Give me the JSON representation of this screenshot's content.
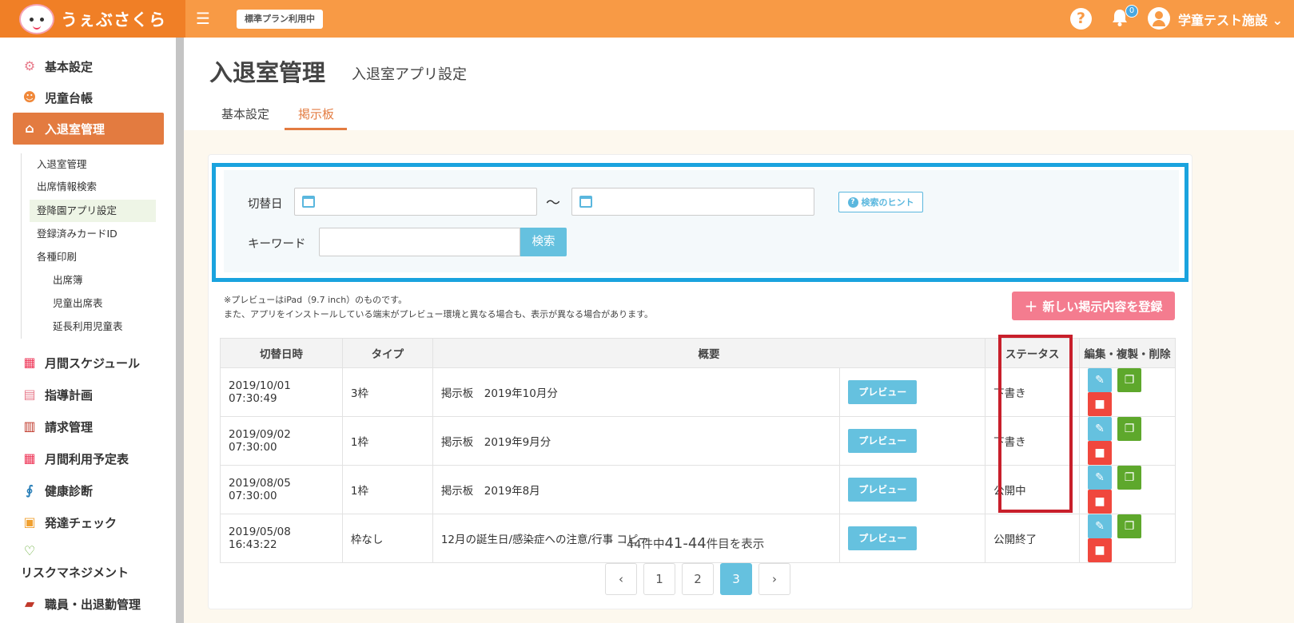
{
  "header": {
    "logo_text": "うぇぶさくら",
    "menu_toggle_glyph": "☰",
    "plan_badge": "標準プラン利用中",
    "notification_count": "0",
    "user_name": "学童テスト施設 ⌄"
  },
  "sidebar": {
    "items": [
      {
        "label": "基本設定",
        "icon": "gear-icon"
      },
      {
        "label": "児童台帳",
        "icon": "child-icon"
      },
      {
        "label": "入退室管理",
        "icon": "building-icon"
      },
      {
        "label": "月間スケジュール",
        "icon": "calendar-icon"
      },
      {
        "label": "指導計画",
        "icon": "notebook-icon"
      },
      {
        "label": "請求管理",
        "icon": "calculator-icon"
      },
      {
        "label": "月間利用予定表",
        "icon": "calendar-clock-icon"
      },
      {
        "label": "健康診断",
        "icon": "stethoscope-icon"
      },
      {
        "label": "発達チェック",
        "icon": "clipboard-icon"
      },
      {
        "label": "リスクマネジメント",
        "icon": "hands-icon"
      },
      {
        "label": "職員・出退勤管理",
        "icon": "briefcase-icon"
      }
    ],
    "sub_items": [
      {
        "label": "入退室管理"
      },
      {
        "label": "出席情報検索"
      },
      {
        "label": "登降園アプリ設定"
      },
      {
        "label": "登録済みカードID"
      },
      {
        "label": "各種印刷"
      },
      {
        "label": "出席簿"
      },
      {
        "label": "児童出席表"
      },
      {
        "label": "延長利用児童表"
      }
    ]
  },
  "page": {
    "title": "入退室管理",
    "subtitle": "入退室アプリ設定",
    "tabs": [
      {
        "label": "基本設定",
        "active": false
      },
      {
        "label": "掲示板",
        "active": true
      }
    ]
  },
  "search": {
    "date_label": "切替日",
    "tilde": "〜",
    "hint_label": "検索のヒント",
    "keyword_label": "キーワード",
    "search_button": "検索"
  },
  "notes": {
    "line1": "※プレビューはiPad（9.7 inch）のものです。",
    "line2": "また、アプリをインストールしている端末がプレビュー環境と異なる場合も、表示が異なる場合があります。"
  },
  "new_button": "新しい掲示内容を登録",
  "table": {
    "headers": [
      "切替日時",
      "タイプ",
      "概要",
      "ステータス",
      "編集・複製・削除"
    ],
    "preview_label": "プレビュー",
    "rows": [
      {
        "datetime": "2019/10/01 07:30:49",
        "type": "3枠",
        "summary": "掲示板　2019年10月分",
        "status": "下書き"
      },
      {
        "datetime": "2019/09/02 07:30:00",
        "type": "1枠",
        "summary": "掲示板　2019年9月分",
        "status": "下書き"
      },
      {
        "datetime": "2019/08/05 07:30:00",
        "type": "1枠",
        "summary": "掲示板　2019年8月",
        "status": "公開中"
      },
      {
        "datetime": "2019/05/08 16:43:22",
        "type": "枠なし",
        "summary": "12月の誕生日/感染症への注意/行事 コピー",
        "status": "公開終了"
      }
    ]
  },
  "pagination": {
    "info_prefix": "44件中",
    "info_range": "41-44",
    "info_suffix": "件目を表示",
    "pages": [
      "1",
      "2",
      "3"
    ],
    "current": "3",
    "prev": "‹",
    "next": "›"
  },
  "colors": {
    "header_bg": "#f89a45",
    "accent_orange": "#e37b40",
    "button_blue": "#65c1df",
    "new_button_pink": "#f47c8f",
    "copy_green": "#5ea82c",
    "delete_red": "#f0473d",
    "highlight_blue": "#1aa3de",
    "highlight_red": "#c81f2b"
  }
}
